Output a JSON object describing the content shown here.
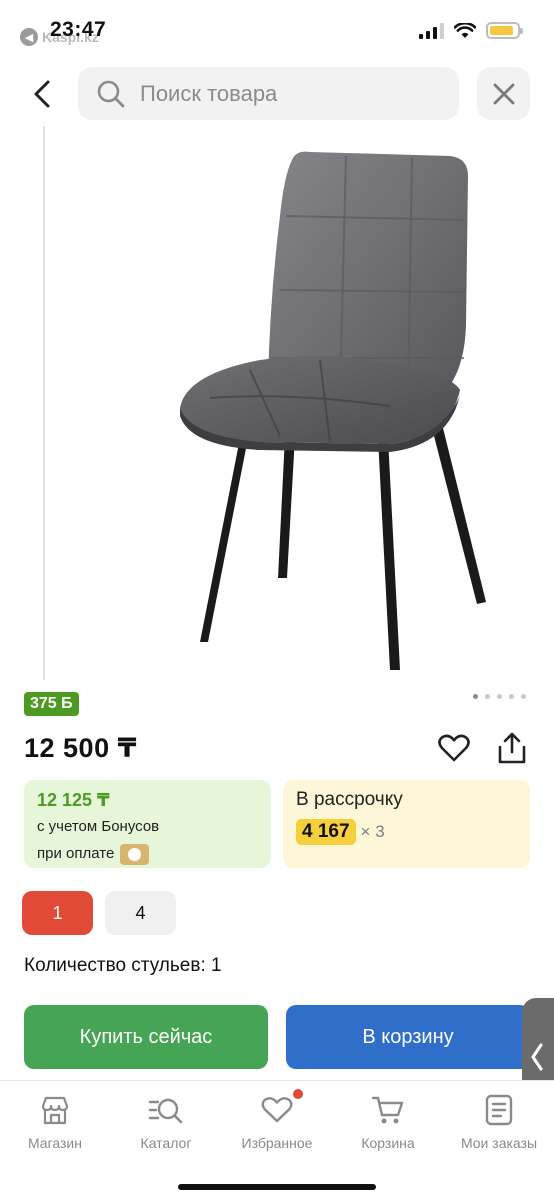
{
  "status_bar": {
    "time": "23:47",
    "back_app": "Kaspi.kz",
    "battery_color": "#f5c842"
  },
  "search": {
    "placeholder": "Поиск товара"
  },
  "product": {
    "bonus_badge": "375 Б",
    "price": "12 500 ₸",
    "image_dots": {
      "count": 5,
      "active_index": 0
    }
  },
  "bonus_card": {
    "price": "12 125 ₸",
    "line1": "с учетом Бонусов",
    "line2": "при оплате",
    "color": "#e7f5d8"
  },
  "installment_card": {
    "title": "В рассрочку",
    "amount": "4 167",
    "multiplier": "× 3",
    "color": "#fdf6d7"
  },
  "options": {
    "items": [
      "1",
      "4"
    ],
    "selected": "1",
    "selected_color": "#e04a36"
  },
  "quantity": {
    "label": "Количество стульев: 1"
  },
  "actions": {
    "buy_now": "Купить сейчас",
    "add_to_cart": "В корзину",
    "buy_color": "#45a554",
    "cart_color": "#2f6ec9"
  },
  "bottom_nav": {
    "items": [
      {
        "label": "Магазин",
        "icon": "shop-icon"
      },
      {
        "label": "Каталог",
        "icon": "catalog-search-icon"
      },
      {
        "label": "Избранное",
        "icon": "heart-icon",
        "has_badge": true
      },
      {
        "label": "Корзина",
        "icon": "cart-icon"
      },
      {
        "label": "Мои заказы",
        "icon": "orders-icon"
      }
    ]
  }
}
